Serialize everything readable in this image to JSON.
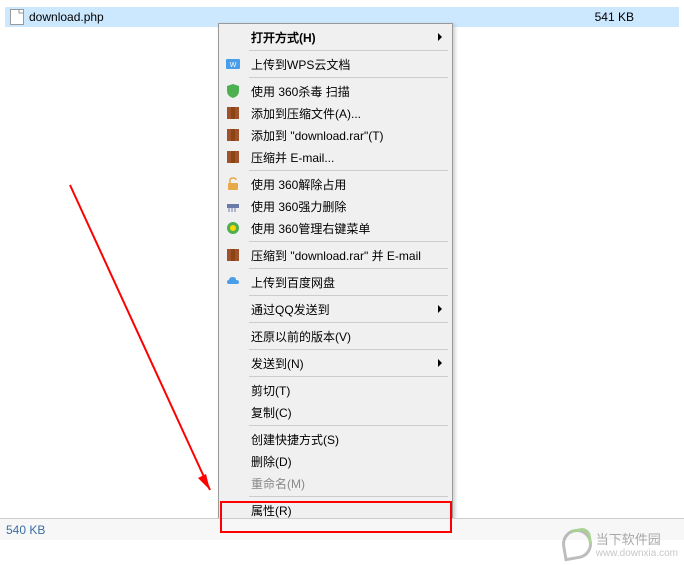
{
  "file": {
    "name": "download.php",
    "size": "541 KB"
  },
  "menu": {
    "open_with": "打开方式(H)",
    "wps_upload": "上传到WPS云文档",
    "scan_360": "使用 360杀毒 扫描",
    "add_archive": "添加到压缩文件(A)...",
    "add_rar": "添加到 \"download.rar\"(T)",
    "compress_email": "压缩并 E-mail...",
    "release_360": "使用 360解除占用",
    "force_delete_360": "使用 360强力删除",
    "manage_360": "使用 360管理右键菜单",
    "compress_rar_email": "压缩到 \"download.rar\" 并 E-mail",
    "baidu_upload": "上传到百度网盘",
    "qq_send": "通过QQ发送到",
    "restore": "还原以前的版本(V)",
    "send_to": "发送到(N)",
    "cut": "剪切(T)",
    "copy": "复制(C)",
    "shortcut": "创建快捷方式(S)",
    "delete": "删除(D)",
    "rename": "重命名(M)",
    "properties": "属性(R)"
  },
  "status": {
    "size": "540 KB"
  },
  "watermark": {
    "name": "当下软件园",
    "url": "www.downxia.com"
  }
}
